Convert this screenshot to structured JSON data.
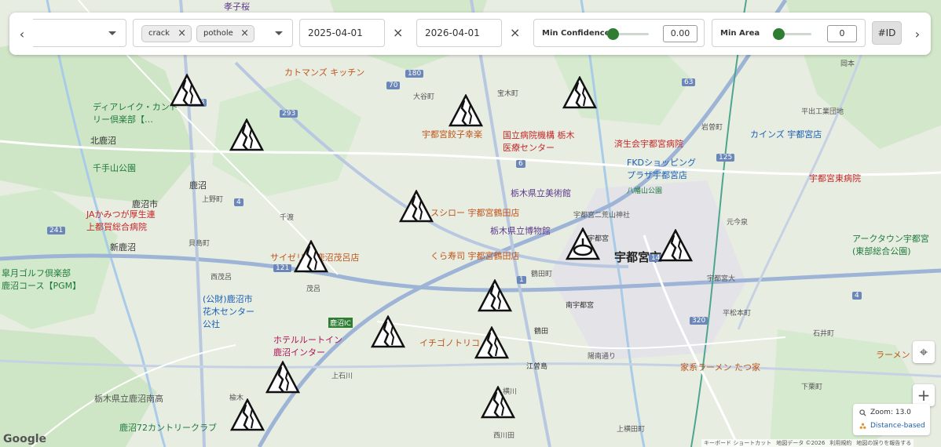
{
  "toolbar": {
    "category_select_value": "",
    "type_chips": [
      {
        "label": "crack",
        "remove_icon": "×"
      },
      {
        "label": "pothole",
        "remove_icon": "×"
      }
    ],
    "date_start": "2025-04-01",
    "date_end": "2026-04-01",
    "clear_icon": "×",
    "min_confidence": {
      "label": "Min Confidence",
      "value": "0.00",
      "level": 0
    },
    "min_area": {
      "label": "Min Area",
      "value": "0",
      "level": 0
    },
    "id_button_label": "#ID",
    "prev_icon": "‹",
    "next_icon": "›"
  },
  "map_controls": {
    "recenter_icon": "⌖",
    "zoom_in_icon": "+"
  },
  "legend": {
    "zoom": "Zoom: 13.0",
    "mode": "Distance-based",
    "zoom_icon": "magnifier-icon",
    "mode_icon": "cluster-icon"
  },
  "map": {
    "google_logo": "Google",
    "attribution": [
      "キーボード ショートカット",
      "地図データ ©2026",
      "利用規約",
      "地図の誤りを報告する"
    ],
    "place_labels": [
      {
        "text": "孝子桜",
        "color": "#5e3a8c"
      },
      {
        "text": "カトマンズ キッチン",
        "color": "#c0561b"
      },
      {
        "text": "ディアレイク・カントリー倶楽部【…",
        "color": "#1e7a3c"
      },
      {
        "text": "北鹿沼",
        "color": "#333"
      },
      {
        "text": "千手山公園",
        "color": "#1e7a3c"
      },
      {
        "text": "鹿沼市",
        "color": "#333"
      },
      {
        "text": "鹿沼",
        "color": "#333"
      },
      {
        "text": "JAかみつが厚生連 上都賀総合病院",
        "color": "#c62828"
      },
      {
        "text": "新鹿沼",
        "color": "#333"
      },
      {
        "text": "皐月ゴルフ倶楽部 鹿沼コース【PGM】",
        "color": "#1e7a3c"
      },
      {
        "text": "(公財)鹿沼市 花木センター公社",
        "color": "#1a5fb4"
      },
      {
        "text": "サイゼリヤ 鹿沼茂呂店",
        "color": "#c0561b"
      },
      {
        "text": "ホテルルートイン 鹿沼インター",
        "color": "#ad1457"
      },
      {
        "text": "イチゴノトリコ",
        "color": "#c0561b"
      },
      {
        "text": "宇都宮餃子幸楽",
        "color": "#c0561b"
      },
      {
        "text": "国立病院機構 栃木医療センター",
        "color": "#c62828"
      },
      {
        "text": "済生会宇都宮病院",
        "color": "#c62828"
      },
      {
        "text": "FKDショッピング プラザ宇都宮店",
        "color": "#1a5fb4"
      },
      {
        "text": "カインズ 宇都宮店",
        "color": "#1a5fb4"
      },
      {
        "text": "宇都宮東病院",
        "color": "#c62828"
      },
      {
        "text": "栃木県立美術館",
        "color": "#5e3a8c"
      },
      {
        "text": "スシロー 宇都宮鶴田店",
        "color": "#c0561b"
      },
      {
        "text": "栃木県立博物館",
        "color": "#5e3a8c"
      },
      {
        "text": "くら寿司 宇都宮鶴田店",
        "color": "#c0561b"
      },
      {
        "text": "宇都宮市",
        "color": "#222"
      },
      {
        "text": "アークタウン宇都宮 (東部総合公園)",
        "color": "#1e7a3c"
      },
      {
        "text": "家系ラーメン たつ家",
        "color": "#c0561b"
      },
      {
        "text": "鹿沼72カントリークラブ",
        "color": "#1e7a3c"
      },
      {
        "text": "栃木県立鹿沼南高",
        "color": "#555"
      },
      {
        "text": "宇都宮二荒山神社",
        "color": "#555"
      },
      {
        "text": "八幡山公園",
        "color": "#1e7a3c"
      },
      {
        "text": "宇都宮",
        "color": "#333"
      },
      {
        "text": "南宇都宮",
        "color": "#333"
      },
      {
        "text": "江曽島",
        "color": "#333"
      },
      {
        "text": "鶴田",
        "color": "#333"
      },
      {
        "text": "千渡",
        "color": "#555"
      },
      {
        "text": "茂呂",
        "color": "#555"
      },
      {
        "text": "西茂呂",
        "color": "#555"
      },
      {
        "text": "上野町",
        "color": "#555"
      },
      {
        "text": "貝島町",
        "color": "#555"
      },
      {
        "text": "楡木",
        "color": "#555"
      },
      {
        "text": "上石川",
        "color": "#555"
      },
      {
        "text": "岩曽町",
        "color": "#555"
      },
      {
        "text": "平出工業団地",
        "color": "#555"
      },
      {
        "text": "元今泉",
        "color": "#555"
      },
      {
        "text": "宇都宮大",
        "color": "#555"
      },
      {
        "text": "平松本町",
        "color": "#555"
      },
      {
        "text": "石井町",
        "color": "#555"
      },
      {
        "text": "下栗町",
        "color": "#555"
      },
      {
        "text": "岡本",
        "color": "#555"
      },
      {
        "text": "宝木町",
        "color": "#555"
      },
      {
        "text": "大谷町",
        "color": "#555"
      },
      {
        "text": "ラーメン",
        "color": "#c0561b"
      },
      {
        "text": "鹿沼IC",
        "color": "#fff"
      },
      {
        "text": "鶴田町",
        "color": "#555"
      },
      {
        "text": "横川",
        "color": "#555"
      },
      {
        "text": "西川田",
        "color": "#555"
      },
      {
        "text": "上横田町",
        "color": "#555"
      },
      {
        "text": "陽南通り",
        "color": "#555"
      }
    ],
    "route_numbers": [
      "70",
      "268",
      "293",
      "180",
      "6",
      "63",
      "125",
      "4",
      "121",
      "14",
      "320",
      "241",
      "1",
      "4"
    ]
  }
}
